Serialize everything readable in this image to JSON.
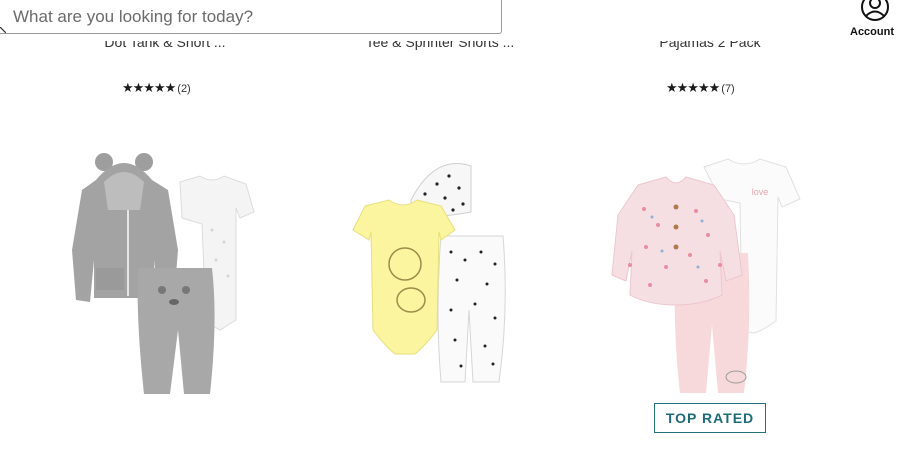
{
  "search": {
    "placeholder": "What are you looking for today?"
  },
  "account": {
    "label": "Account"
  },
  "products_top": [
    {
      "title": "Dot Tank & Short ...",
      "stars": "★★★★★",
      "count": "(2)"
    },
    {
      "title": "Tee & Sprinter Shorts ..."
    },
    {
      "title": "Pajamas 2 Pack",
      "stars": "★★★★★",
      "count": "(7)"
    }
  ],
  "products": [
    {
      "image": "gray-bear-hoodie-set"
    },
    {
      "image": "pooh-bodysuit-dot-set"
    },
    {
      "image": "floral-cardigan-set",
      "badge": "TOP RATED"
    }
  ],
  "colors": {
    "badge": "#1d6b78",
    "text": "#333333"
  }
}
